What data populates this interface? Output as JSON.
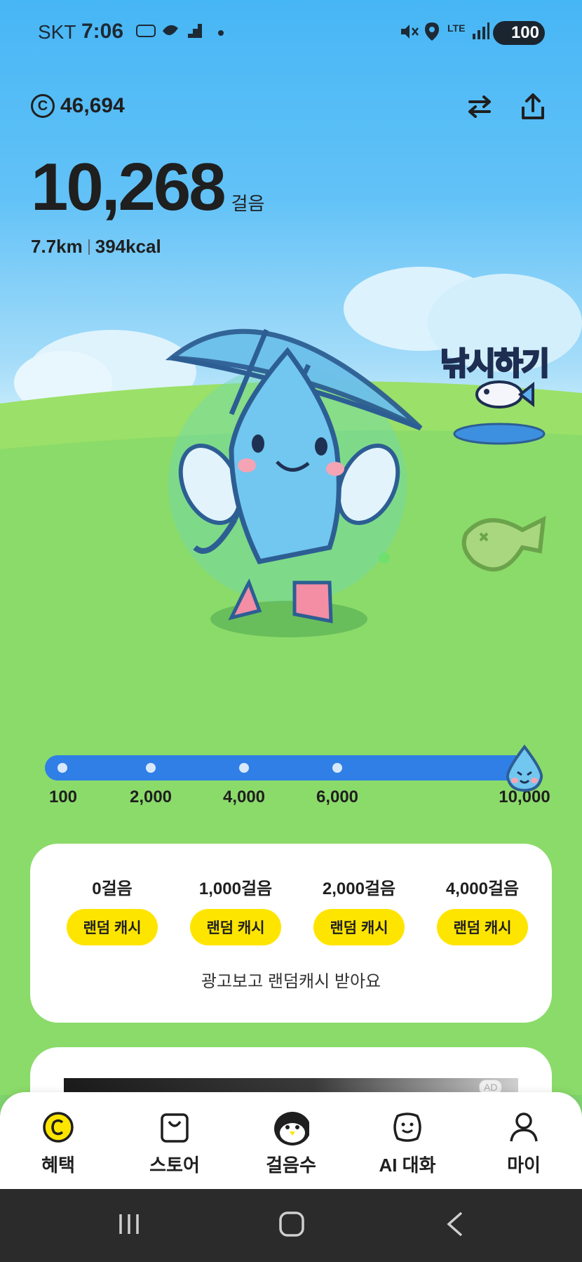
{
  "status_bar": {
    "carrier": "SKT",
    "time": "7:06",
    "network": "LTE",
    "battery": "100"
  },
  "header": {
    "coin_balance": "46,694"
  },
  "steps": {
    "count": "10,268",
    "unit": "걸음",
    "distance": "7.7km",
    "calories": "394kcal"
  },
  "features": {
    "fishing_label": "낚시하기"
  },
  "progress": {
    "current_steps": 10268,
    "max_steps": 10000,
    "milestones": [
      "100",
      "2,000",
      "4,000",
      "6,000",
      "10,000"
    ]
  },
  "rewards": {
    "items": [
      {
        "steps": "0걸음",
        "button": "랜덤 캐시"
      },
      {
        "steps": "1,000걸음",
        "button": "랜덤 캐시"
      },
      {
        "steps": "2,000걸음",
        "button": "랜덤 캐시"
      },
      {
        "steps": "4,000걸음",
        "button": "랜덤 캐시"
      }
    ],
    "caption": "광고보고 랜덤캐시 받아요"
  },
  "ad": {
    "badge": "AD"
  },
  "bottom_nav": {
    "items": [
      {
        "label": "혜택",
        "icon": "coin-icon"
      },
      {
        "label": "스토어",
        "icon": "shopping-bag-icon"
      },
      {
        "label": "걸음수",
        "icon": "penguin-icon"
      },
      {
        "label": "AI 대화",
        "icon": "smile-bubble-icon"
      },
      {
        "label": "마이",
        "icon": "person-icon"
      }
    ],
    "active_index": 2
  },
  "colors": {
    "sky": "#47b6f5",
    "grass": "#78d36a",
    "progress": "#2f7fe6",
    "reward_button": "#fee500"
  }
}
